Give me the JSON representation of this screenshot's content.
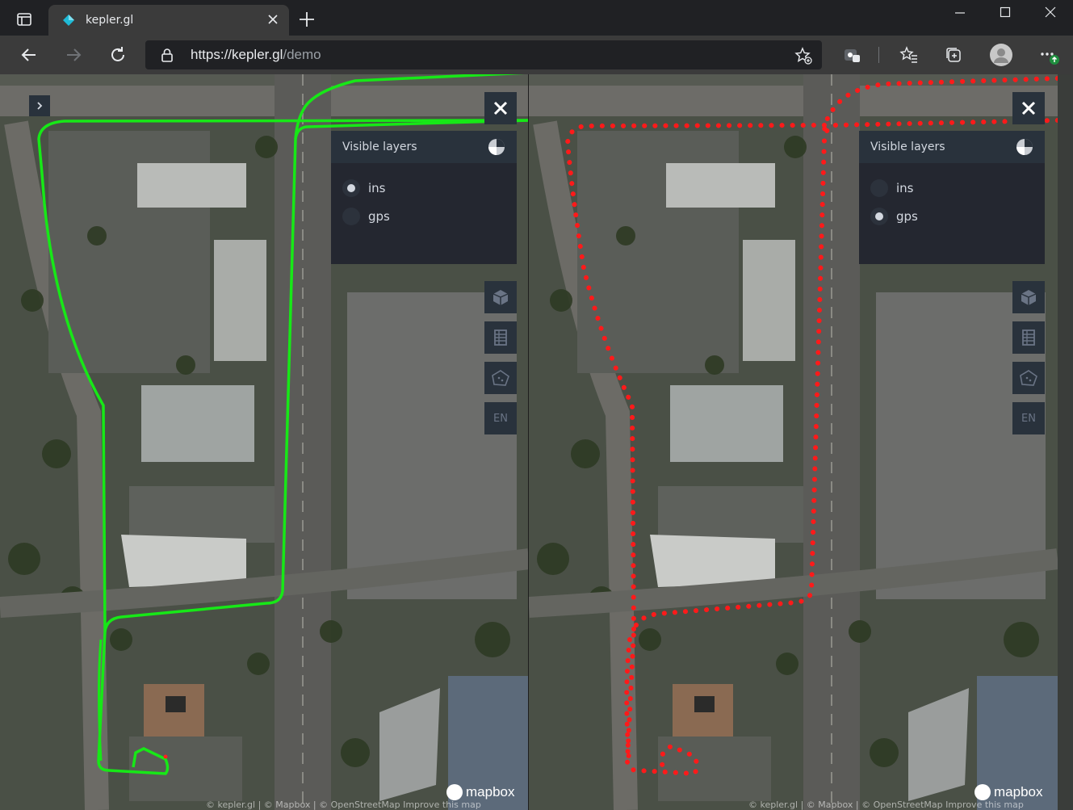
{
  "browser": {
    "tab_title": "kepler.gl",
    "url_host": "https://kepler.gl",
    "url_path": "/demo"
  },
  "colors": {
    "ins_path": "#17e817",
    "gps_points": "#ff1a1a",
    "panel_bg": "#242730",
    "panel_head": "#29323c"
  },
  "maps": [
    {
      "legend_title": "Visible layers",
      "layers": [
        {
          "label": "ins",
          "active": true
        },
        {
          "label": "gps",
          "active": false
        }
      ],
      "locale_button": "EN",
      "logo_text": "mapbox",
      "attribution": "© kepler.gl | © Mapbox | © OpenStreetMap Improve this map"
    },
    {
      "legend_title": "Visible layers",
      "layers": [
        {
          "label": "ins",
          "active": false
        },
        {
          "label": "gps",
          "active": true
        }
      ],
      "locale_button": "EN",
      "logo_text": "mapbox",
      "attribution": "© kepler.gl | © Mapbox | © OpenStreetMap Improve this map"
    }
  ]
}
